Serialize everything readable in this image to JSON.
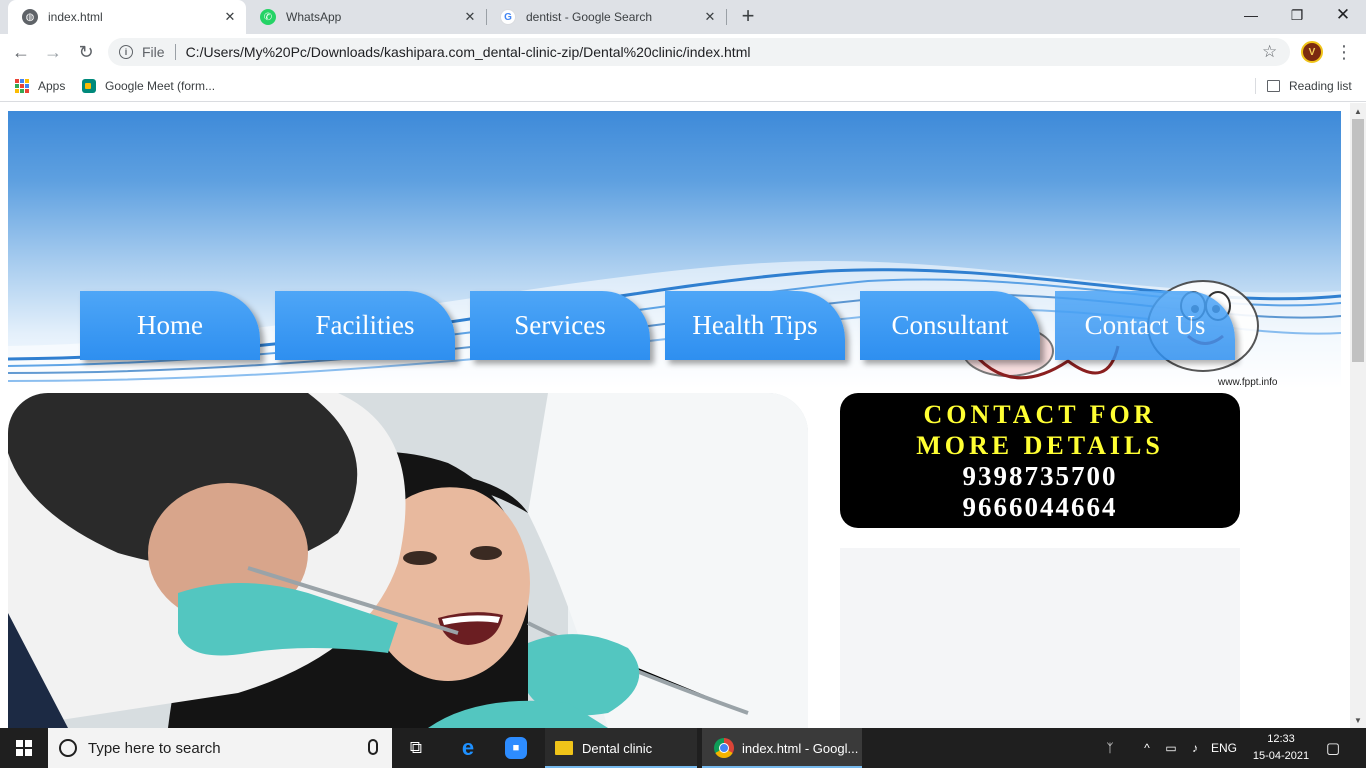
{
  "browser": {
    "tabs": [
      {
        "title": "index.html",
        "active": true,
        "icon": "globe-icon"
      },
      {
        "title": "WhatsApp",
        "active": false,
        "icon": "whatsapp-icon"
      },
      {
        "title": "dentist - Google Search",
        "active": false,
        "icon": "google-icon"
      }
    ],
    "url_scheme": "File",
    "url": "C:/Users/My%20Pc/Downloads/kashipara.com_dental-clinic-zip/Dental%20clinic/index.html",
    "bookmarks": [
      {
        "label": "Apps",
        "icon": "apps-grid-icon"
      },
      {
        "label": "Google Meet (form...",
        "icon": "google-meet-icon"
      }
    ],
    "reading_list": "Reading list"
  },
  "page": {
    "nav": [
      "Home",
      "Facilities",
      "Services",
      "Health Tips",
      "Consultant",
      "Contact Us"
    ],
    "watermark": "www.fppt.info",
    "contact": {
      "title": "CONTACT FOR MORE DETAILS",
      "phone1": "9398735700",
      "phone2": "9666044664"
    }
  },
  "taskbar": {
    "search_placeholder": "Type here to search",
    "apps": [
      {
        "label": "Dental clinic",
        "icon": "folder-icon"
      },
      {
        "label": "index.html - Googl...",
        "icon": "chrome-icon"
      }
    ],
    "language": "ENG",
    "time": "12:33",
    "date": "15-04-2021"
  },
  "colors": {
    "nav_button": "#2e8ff0",
    "contact_bg": "#000000",
    "contact_title": "#ffff33",
    "tabstrip": "#dee1e6"
  }
}
